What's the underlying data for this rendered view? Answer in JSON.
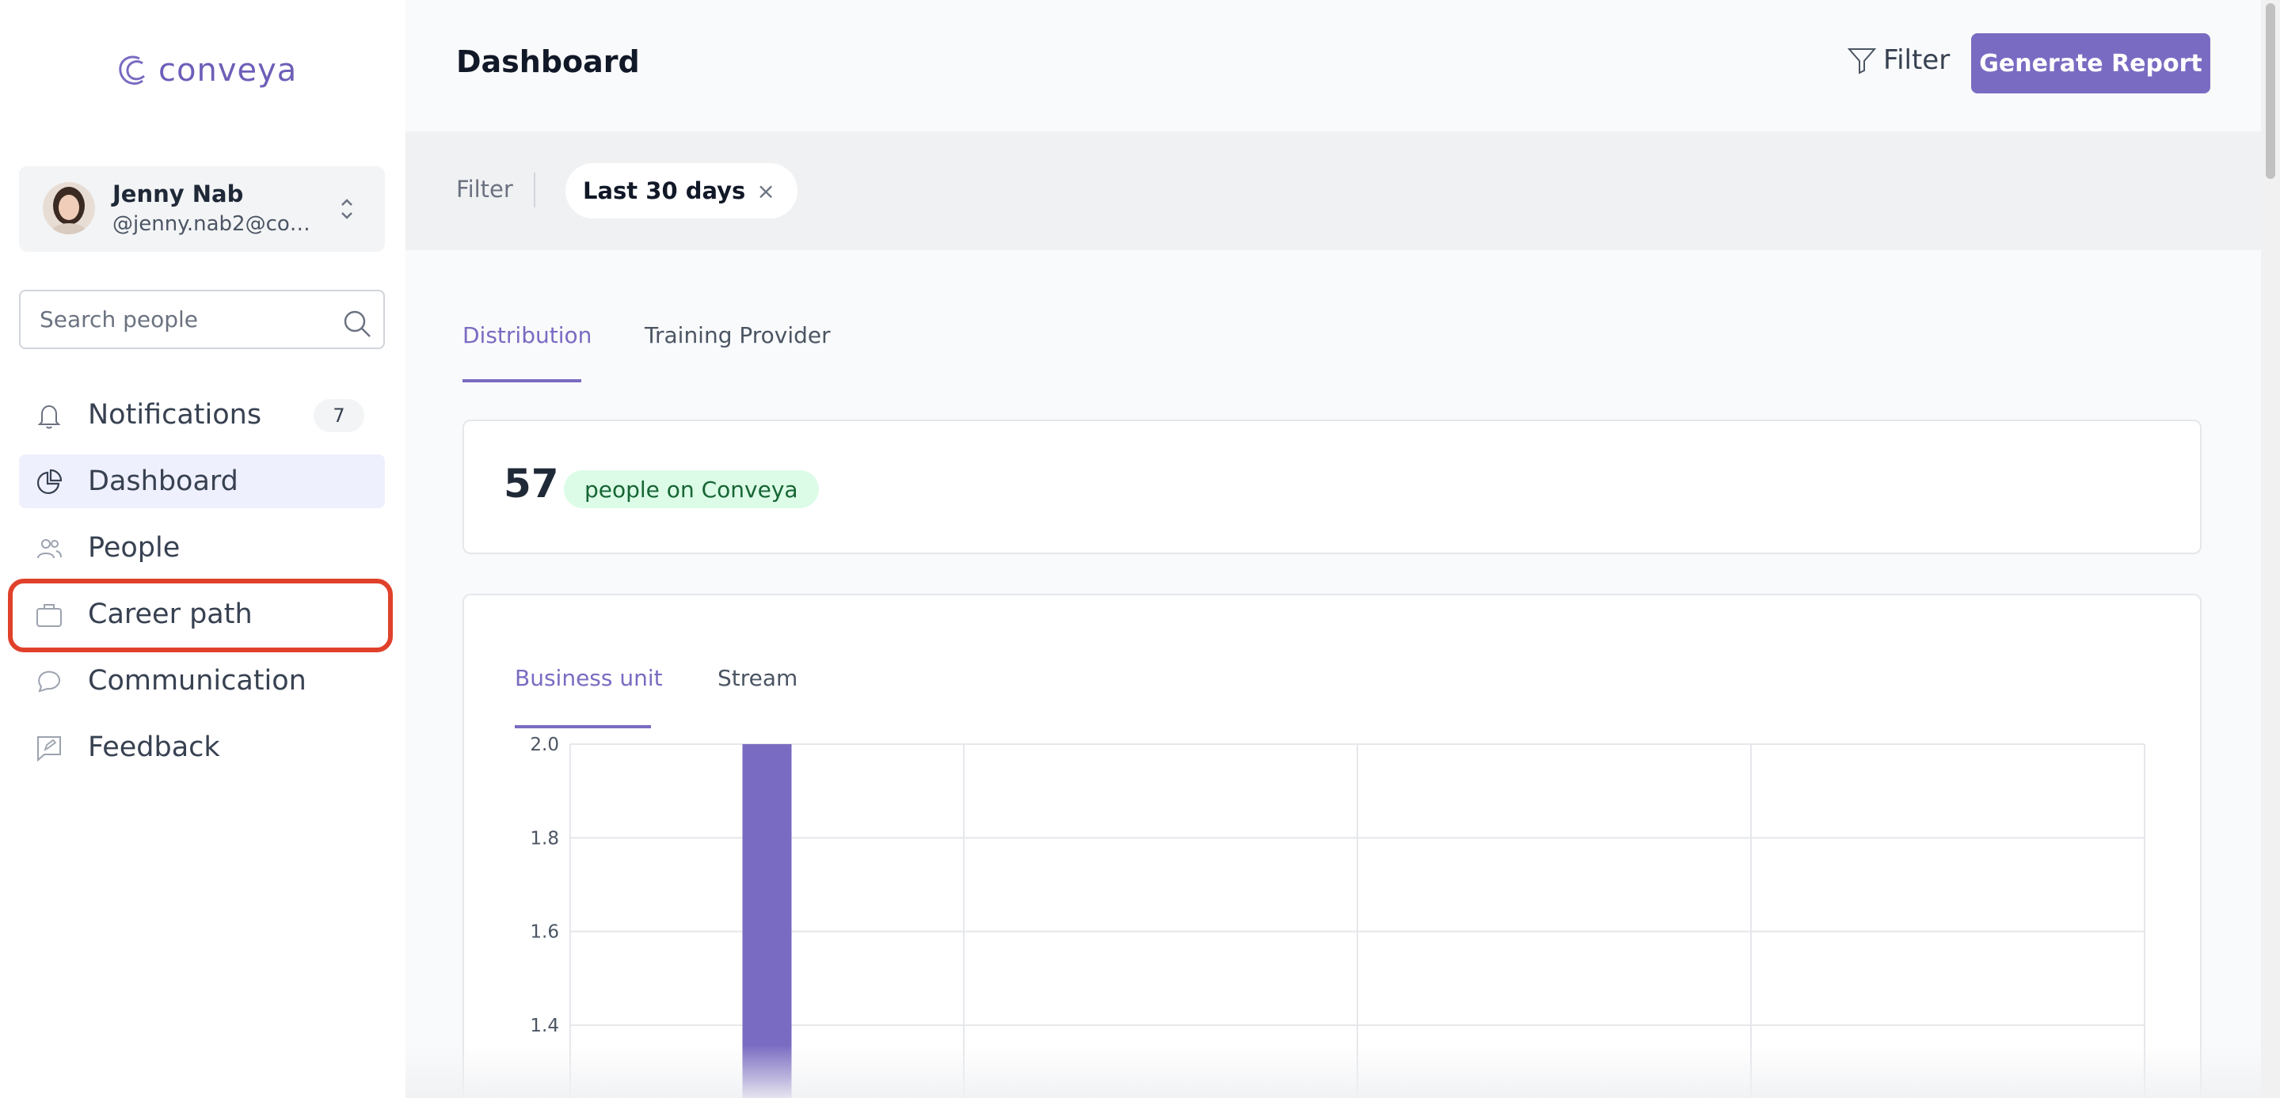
{
  "app": {
    "logo_text": "conveya",
    "brand_color": "#7a6bc2"
  },
  "user": {
    "name": "Jenny Nab",
    "email": "@jenny.nab2@con..."
  },
  "search": {
    "placeholder": "Search people"
  },
  "sidebar": {
    "items": [
      {
        "label": "Notifications",
        "icon": "bell-icon",
        "badge": "7"
      },
      {
        "label": "Dashboard",
        "icon": "pie-chart-icon",
        "active": true
      },
      {
        "label": "People",
        "icon": "users-icon"
      },
      {
        "label": "Career path",
        "icon": "briefcase-icon",
        "highlighted": true
      },
      {
        "label": "Communication",
        "icon": "chat-bubble-icon"
      },
      {
        "label": "Feedback",
        "icon": "feedback-icon"
      }
    ]
  },
  "header": {
    "title": "Dashboard",
    "filter_label": "Filter",
    "generate_label": "Generate Report"
  },
  "filter_bar": {
    "label": "Filter",
    "chip_label": "Last 30 days",
    "chip_close": "×"
  },
  "tabs": [
    {
      "label": "Distribution",
      "active": true
    },
    {
      "label": "Training Provider"
    }
  ],
  "stats": {
    "count": "57",
    "label": "people on Conveya",
    "pill_color": "#dcfce7"
  },
  "chart_tabs": [
    {
      "label": "Business unit",
      "active": true
    },
    {
      "label": "Stream"
    }
  ],
  "chart_data": {
    "type": "bar",
    "title": "",
    "xlabel": "",
    "ylabel": "",
    "categories_visible": 4,
    "values": [
      2.0,
      null,
      null,
      null
    ],
    "yticks": [
      "2.0",
      "1.8",
      "1.6",
      "1.4"
    ],
    "ylim_visible": [
      1.3,
      2.0
    ],
    "grid": true,
    "bar_color": "#7a6bc2"
  }
}
